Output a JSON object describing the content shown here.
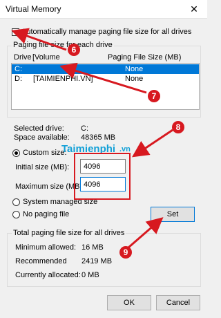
{
  "window": {
    "title": "Virtual Memory",
    "close_label": "✕"
  },
  "auto_manage": {
    "label": "Automatically manage paging file size for all drives",
    "checked": false
  },
  "paging_group": {
    "legend": "Paging file size for each drive",
    "columns": {
      "drive": "Drive",
      "volume": "[Volume",
      "size": "Paging File Size (MB)"
    },
    "rows": [
      {
        "drive": "C:",
        "volume": "",
        "size": "None",
        "selected": true
      },
      {
        "drive": "D:",
        "volume": "[TAIMIENPHI.VN]",
        "size": "None",
        "selected": false
      }
    ]
  },
  "selected_drive": {
    "label": "Selected drive:",
    "value": "C:"
  },
  "space_available": {
    "label": "Space available:",
    "value": "48365 MB"
  },
  "custom_size": {
    "label": "Custom size:",
    "selected": true
  },
  "initial_size": {
    "label": "Initial size (MB):",
    "value": "4096"
  },
  "maximum_size": {
    "label": "Maximum size (MB):",
    "value": "4096"
  },
  "system_managed": {
    "label": "System managed size"
  },
  "no_paging": {
    "label": "No paging file"
  },
  "set_button": {
    "label": "Set"
  },
  "total_group": {
    "legend": "Total paging file size for all drives",
    "minimum": {
      "label": "Minimum allowed:",
      "value": "16 MB"
    },
    "recommended": {
      "label": "Recommended",
      "value": "2419 MB"
    },
    "allocated": {
      "label": "Currently allocated:",
      "value": "0 MB"
    }
  },
  "buttons": {
    "ok": "OK",
    "cancel": "Cancel"
  },
  "watermark": {
    "text": "Taimienphi",
    "suffix": ".vn"
  },
  "annotations": [
    "6",
    "7",
    "8",
    "9"
  ],
  "colors": {
    "accent": "#0078d7",
    "annotation": "#d71920",
    "watermark": "#12a0d7"
  }
}
